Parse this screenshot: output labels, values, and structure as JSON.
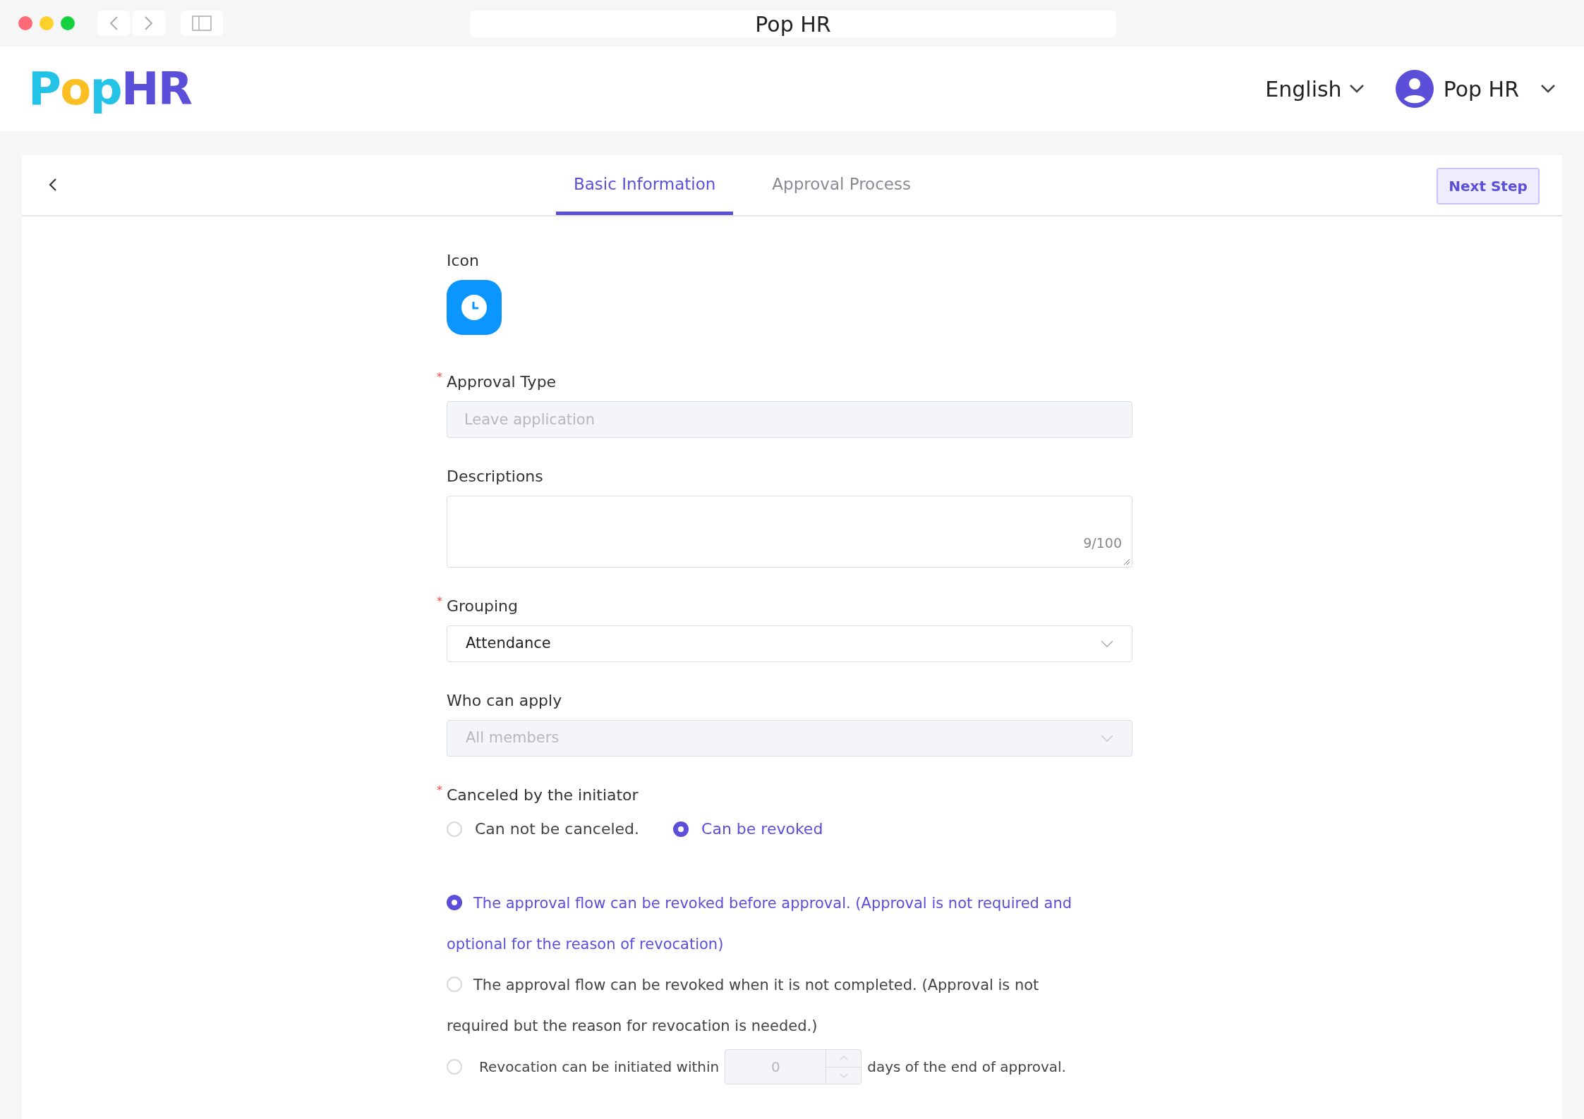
{
  "window": {
    "title": "Pop HR"
  },
  "header": {
    "logo_parts": [
      {
        "text": "P",
        "color": "#22c3e6"
      },
      {
        "text": "o",
        "color": "#fbbf24"
      },
      {
        "text": "p",
        "color": "#22c3e6"
      },
      {
        "text": "HR",
        "color": "#5b4fd9"
      }
    ],
    "language": "English",
    "user": "Pop HR"
  },
  "tabs": [
    {
      "label": "Basic Information",
      "selected": true
    },
    {
      "label": "Approval Process",
      "selected": false
    }
  ],
  "next_button": "Next Step",
  "fields": [
    {
      "kind": "icon",
      "label": "Icon"
    },
    {
      "kind": "input",
      "label": "Approval Type",
      "required_mark": "*",
      "value": "Leave application",
      "disabled": true
    },
    {
      "kind": "textarea",
      "label": "Descriptions",
      "counter": "9/100"
    },
    {
      "kind": "select",
      "label": "Grouping",
      "required_mark": "*",
      "value": "Attendance",
      "disabled": false
    },
    {
      "kind": "select",
      "label": "Who can apply",
      "value": "All members",
      "disabled": true
    },
    {
      "kind": "radio",
      "label": "Canceled by the initiator",
      "required_mark": "*",
      "options": [
        {
          "label": "Can not be canceled.",
          "selected": false
        },
        {
          "label": "Can be revoked",
          "selected": true
        }
      ]
    }
  ],
  "revocation_options": [
    {
      "kind": "text",
      "label": "The approval flow can be revoked before approval. (Approval is not required and optional for the reason of revocation)",
      "selected": true
    },
    {
      "kind": "text",
      "label": "The approval flow can be revoked when it is not completed. (Approval is not required but the reason for revocation is needed.)",
      "selected": false
    },
    {
      "kind": "days",
      "label": "Revocation can be initiated within",
      "value": "0",
      "suffix": "days of the end of approval.",
      "selected": false
    }
  ]
}
